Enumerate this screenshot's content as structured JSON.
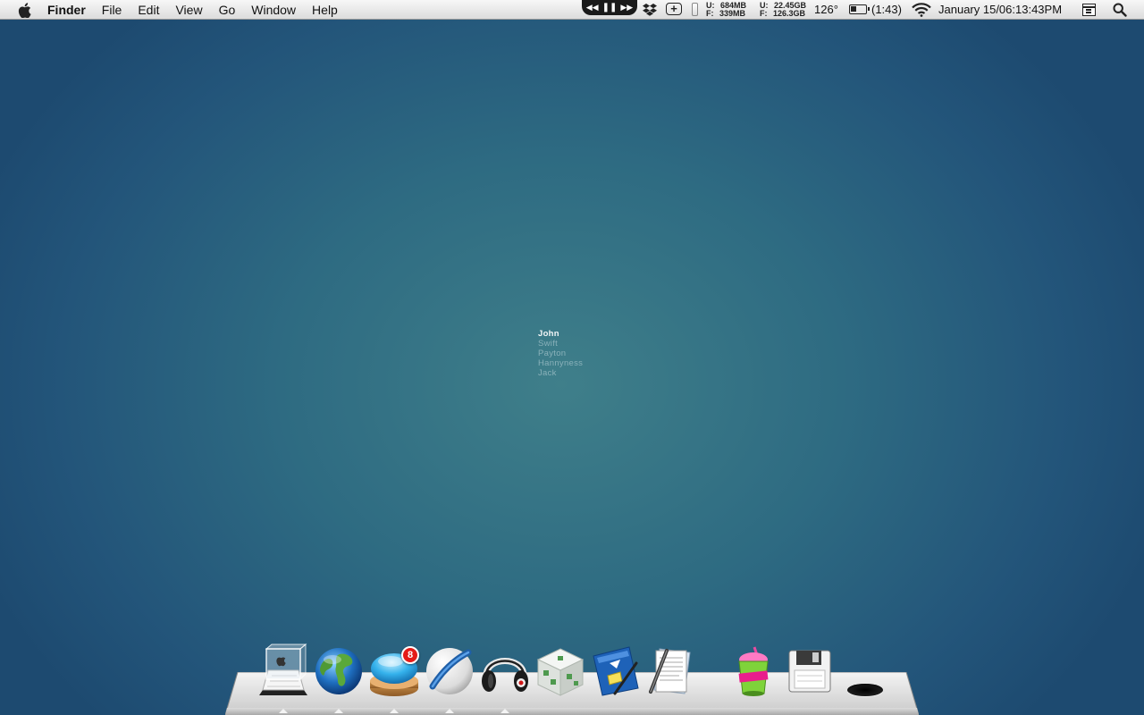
{
  "menubar": {
    "app_name": "Finder",
    "menus": [
      "File",
      "Edit",
      "View",
      "Go",
      "Window",
      "Help"
    ],
    "status": {
      "memory": {
        "used_label": "U:",
        "used": "684MB",
        "free_label": "F:",
        "free": "339MB"
      },
      "disk": {
        "used_label": "U:",
        "used": "22.45GB",
        "free_label": "F:",
        "free": "126.3GB"
      },
      "temperature": "126°",
      "battery_time": "(1:43)",
      "battery_level": 0.4,
      "clock": "January 15/06:13:43PM"
    }
  },
  "desktop": {
    "names": [
      "John",
      "Swift",
      "Payton",
      "Hannyness",
      "Jack"
    ],
    "active_name_index": 0
  },
  "dock": {
    "items": [
      {
        "name": "app-store-icon",
        "running": true
      },
      {
        "name": "globe-icon",
        "running": true
      },
      {
        "name": "chat-bubble-icon",
        "running": true,
        "badge": "8"
      },
      {
        "name": "safari-icon",
        "running": true
      },
      {
        "name": "headphones-icon",
        "running": true
      },
      {
        "name": "cube-icon",
        "running": false
      },
      {
        "name": "mail-pen-icon",
        "running": false
      },
      {
        "name": "text-editor-icon",
        "running": false
      },
      {
        "name": "slushie-cup-icon",
        "running": false
      },
      {
        "name": "floppy-disk-icon",
        "running": false
      },
      {
        "name": "trash-hole-icon",
        "running": false
      }
    ]
  },
  "colors": {
    "badge": "#e41b17",
    "desktop_center": "#3f7f8a",
    "desktop_edge": "#1d4a70"
  }
}
